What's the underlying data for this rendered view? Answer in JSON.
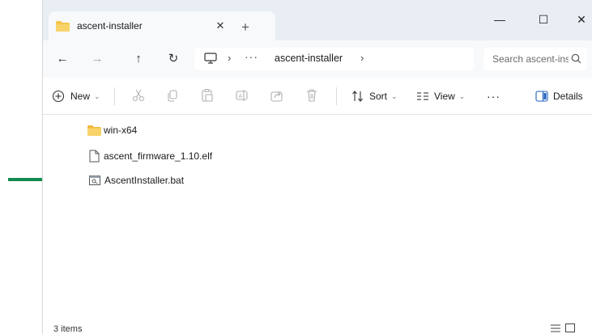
{
  "tab": {
    "title": "ascent-installer",
    "close_glyph": "✕",
    "new_tab_glyph": "+"
  },
  "window_controls": {
    "minimize": "—",
    "maximize": "☐",
    "close": "✕"
  },
  "nav": {
    "back_glyph": "←",
    "forward_glyph": "→",
    "up_glyph": "↑",
    "refresh_glyph": "↻"
  },
  "address": {
    "separator": "›",
    "more": "···",
    "crumb": "ascent-installer"
  },
  "search": {
    "placeholder": "Search ascent-installer"
  },
  "commands": {
    "new_label": "New",
    "sort_label": "Sort",
    "view_label": "View",
    "more_label": "···",
    "details_label": "Details",
    "chevron": "⌄"
  },
  "files": [
    {
      "name": "win-x64",
      "type": "folder"
    },
    {
      "name": "ascent_firmware_1.10.elf",
      "type": "file"
    },
    {
      "name": "AscentInstaller.bat",
      "type": "batch"
    }
  ],
  "status": {
    "item_count": "3 items"
  },
  "colors": {
    "arrow": "#138a4f",
    "folder": "#f5c54a",
    "tab_strip": "#e9eef4",
    "nav_row": "#f7f9fb"
  },
  "icons": [
    "folder-icon",
    "close-icon",
    "plus-icon",
    "minimize-icon",
    "maximize-icon",
    "back-arrow-icon",
    "forward-arrow-icon",
    "up-arrow-icon",
    "refresh-icon",
    "computer-icon",
    "search-icon",
    "new-plus-icon",
    "cut-icon",
    "copy-icon",
    "paste-icon",
    "rename-icon",
    "share-icon",
    "delete-icon",
    "sort-icon",
    "view-icon",
    "details-pane-icon",
    "file-icon",
    "batch-file-icon",
    "green-arrow-icon"
  ]
}
